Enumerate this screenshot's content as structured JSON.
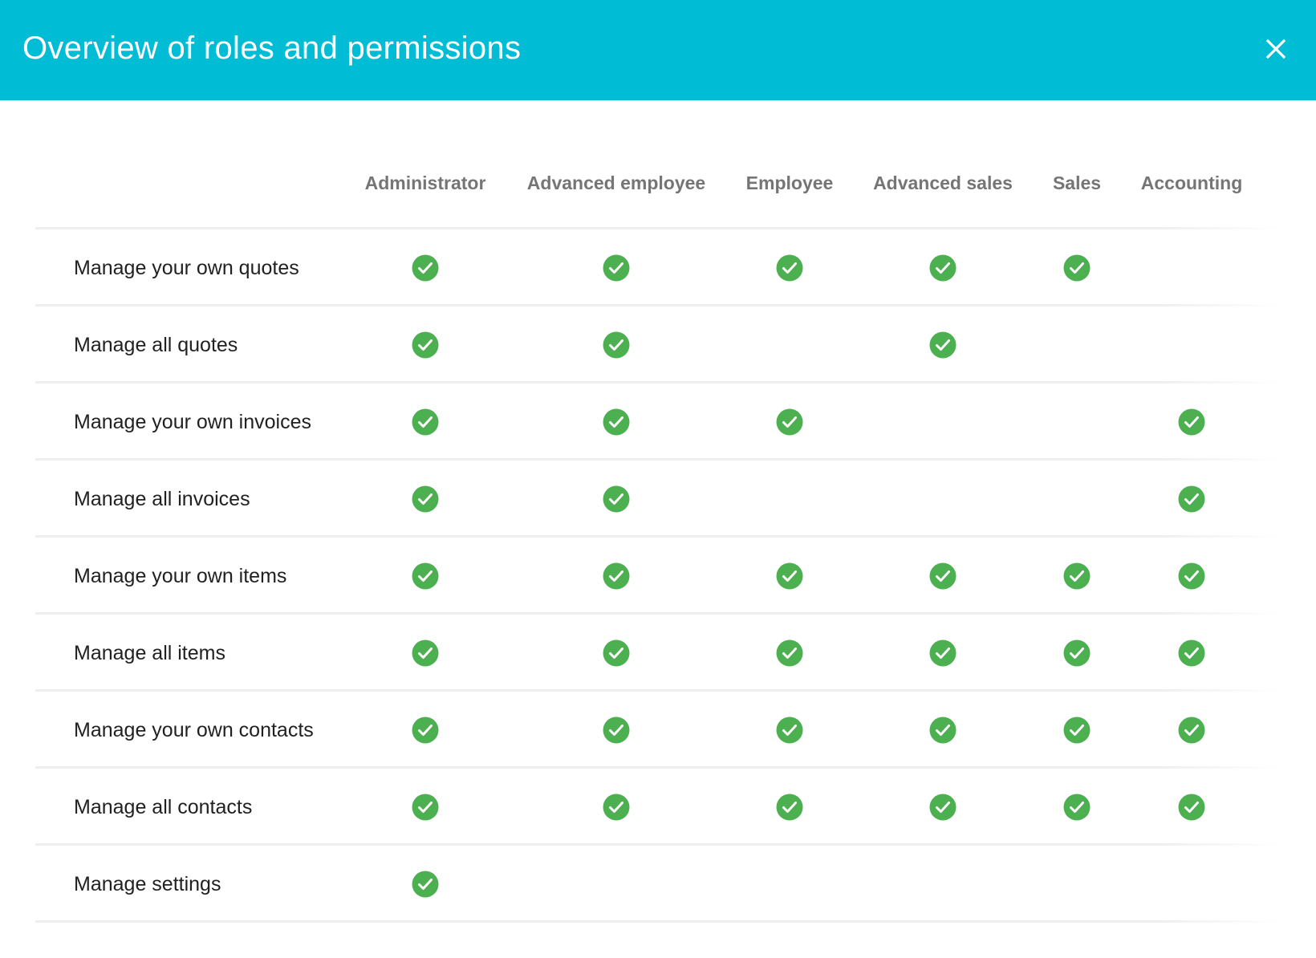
{
  "header": {
    "title": "Overview of roles and permissions",
    "close_icon": "close-icon",
    "background_color": "#00BCD4"
  },
  "table": {
    "columns": [
      "Administrator",
      "Advanced employee",
      "Employee",
      "Advanced sales",
      "Sales",
      "Accounting"
    ],
    "check_icon": "check-circle-icon",
    "check_color": "#4CAF50",
    "rows": [
      {
        "label": "Manage your own quotes",
        "permissions": [
          true,
          true,
          true,
          true,
          true,
          false
        ]
      },
      {
        "label": "Manage all quotes",
        "permissions": [
          true,
          true,
          false,
          true,
          false,
          false
        ]
      },
      {
        "label": "Manage your own invoices",
        "permissions": [
          true,
          true,
          true,
          false,
          false,
          true
        ]
      },
      {
        "label": "Manage all invoices",
        "permissions": [
          true,
          true,
          false,
          false,
          false,
          true
        ]
      },
      {
        "label": "Manage your own items",
        "permissions": [
          true,
          true,
          true,
          true,
          true,
          true
        ]
      },
      {
        "label": "Manage all items",
        "permissions": [
          true,
          true,
          true,
          true,
          true,
          true
        ]
      },
      {
        "label": "Manage your own contacts",
        "permissions": [
          true,
          true,
          true,
          true,
          true,
          true
        ]
      },
      {
        "label": "Manage all contacts",
        "permissions": [
          true,
          true,
          true,
          true,
          true,
          true
        ]
      },
      {
        "label": "Manage settings",
        "permissions": [
          true,
          false,
          false,
          false,
          false,
          false
        ]
      }
    ]
  }
}
